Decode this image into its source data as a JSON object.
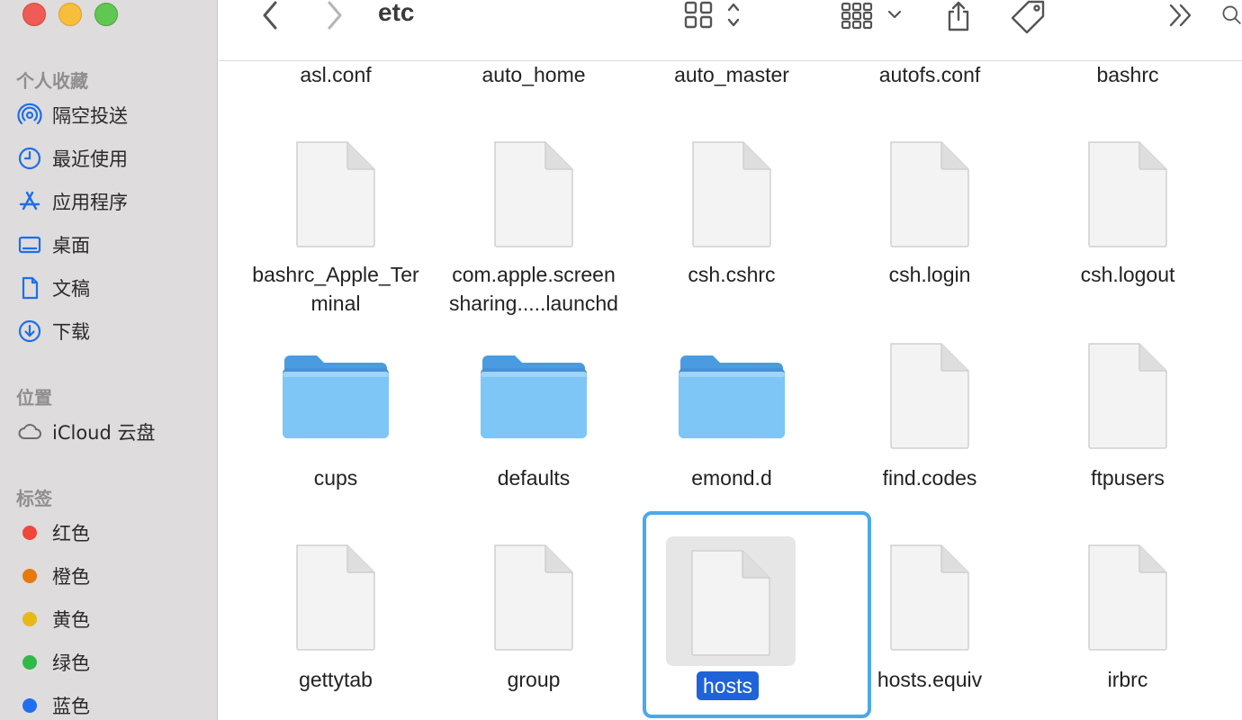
{
  "window": {
    "folder_title": "etc"
  },
  "sidebar": {
    "favorites_title": "个人收藏",
    "favorites": [
      {
        "label": "隔空投送",
        "icon": "airdrop-icon"
      },
      {
        "label": "最近使用",
        "icon": "clock-icon"
      },
      {
        "label": "应用程序",
        "icon": "applications-icon"
      },
      {
        "label": "桌面",
        "icon": "desktop-icon"
      },
      {
        "label": "文稿",
        "icon": "document-icon"
      },
      {
        "label": "下载",
        "icon": "download-icon"
      }
    ],
    "locations_title": "位置",
    "locations": [
      {
        "label": "iCloud 云盘",
        "icon": "cloud-icon"
      }
    ],
    "tags_title": "标签",
    "tags": [
      {
        "label": "红色",
        "color": "#f0463c"
      },
      {
        "label": "橙色",
        "color": "#e8790f"
      },
      {
        "label": "黄色",
        "color": "#e8b817"
      },
      {
        "label": "绿色",
        "color": "#30b94a"
      },
      {
        "label": "蓝色",
        "color": "#1f6ef0"
      }
    ]
  },
  "toolbar": {
    "back_icon": "chevron-left-icon",
    "forward_icon": "chevron-right-icon",
    "view_icon": "grid-view-icon",
    "group_icon": "group-by-icon",
    "share_icon": "share-icon",
    "tag_icon": "tag-icon",
    "more_icon": "double-chevron-right-icon",
    "search_icon": "search-icon"
  },
  "files": {
    "row0": [
      "asl.conf",
      "auto_home",
      "auto_master",
      "autofs.conf",
      "bashrc"
    ],
    "row1": [
      "bashrc_Apple_Terminal",
      "com.apple.screensharing.....launchd",
      "csh.cshrc",
      "csh.login",
      "csh.logout"
    ],
    "row1_lines": [
      [
        "bashrc_Apple_Ter",
        "minal"
      ],
      [
        "com.apple.screen",
        "sharing.....launchd"
      ],
      [
        "csh.cshrc"
      ],
      [
        "csh.login"
      ],
      [
        "csh.logout"
      ]
    ],
    "row2": [
      {
        "name": "cups",
        "kind": "folder"
      },
      {
        "name": "defaults",
        "kind": "folder"
      },
      {
        "name": "emond.d",
        "kind": "folder"
      },
      {
        "name": "find.codes",
        "kind": "file"
      },
      {
        "name": "ftpusers",
        "kind": "file"
      }
    ],
    "row3": [
      "gettytab",
      "group",
      "hosts",
      "hosts.equiv",
      "irbrc"
    ],
    "selected": "hosts",
    "colors": {
      "selection_border": "#4aa9ec",
      "selection_label": "#1f63d8",
      "folder": "#7ec6f5"
    }
  }
}
